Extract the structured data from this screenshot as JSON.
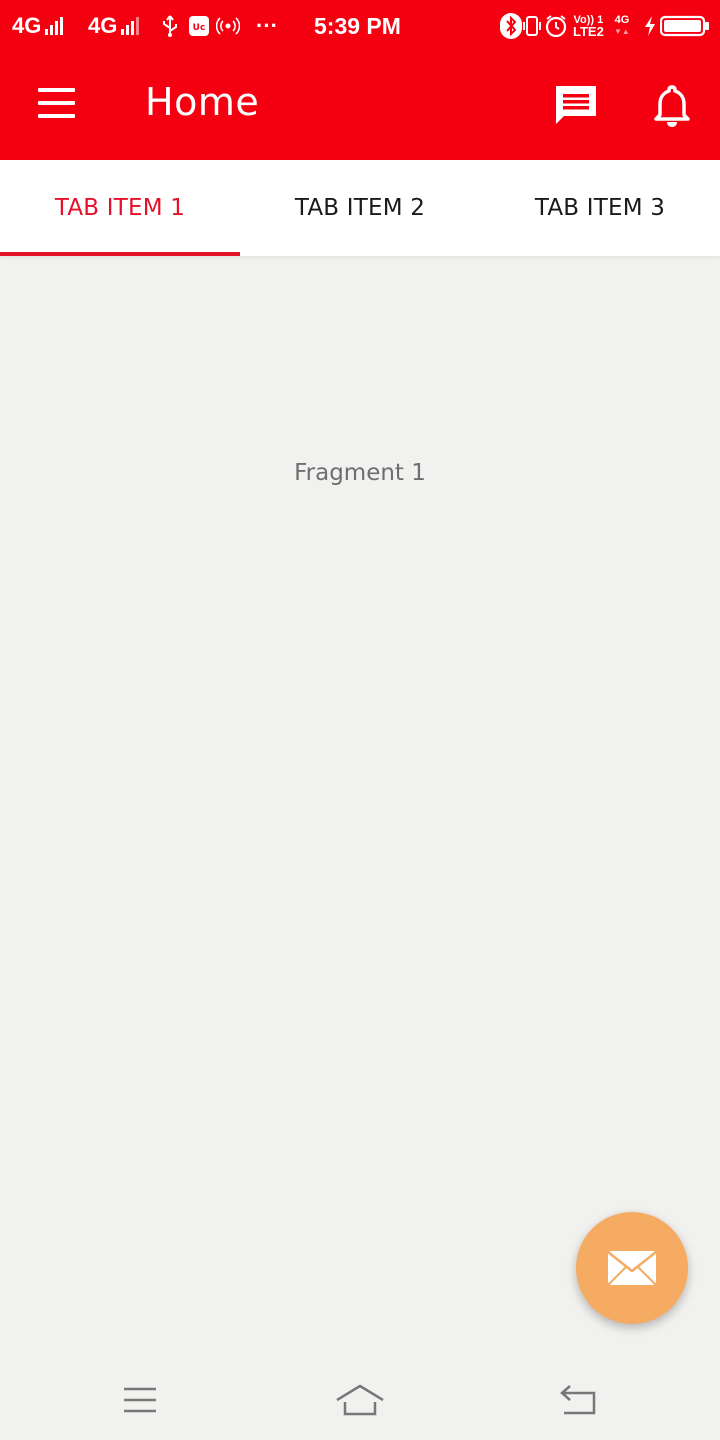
{
  "status_bar": {
    "network1": "4G",
    "network2": "4G",
    "overflow": "···",
    "time": "5:39 PM",
    "volte_line1": "Vo)) 1",
    "volte_line2": "LTE2",
    "network3": "4G",
    "icons": [
      "usb-icon",
      "app-notification-icon",
      "hotspot-icon",
      "bluetooth-icon",
      "vibrate-icon",
      "alarm-icon",
      "charging-icon",
      "battery-icon"
    ]
  },
  "app_bar": {
    "title": "Home",
    "color": "#f40010",
    "icons": [
      "menu-icon",
      "message-icon",
      "bell-icon"
    ]
  },
  "tabs": [
    {
      "label": "TAB ITEM 1",
      "active": true
    },
    {
      "label": "TAB ITEM 2",
      "active": false
    },
    {
      "label": "TAB ITEM 3",
      "active": false
    }
  ],
  "content": {
    "fragment_text": "Fragment 1"
  },
  "fab": {
    "icon": "envelope-icon",
    "color": "#f6ab62"
  },
  "nav_bar": {
    "icons": [
      "recent-apps-icon",
      "home-icon",
      "back-icon"
    ]
  },
  "colors": {
    "accent": "#e3122a",
    "background": "#f1f1ef"
  }
}
